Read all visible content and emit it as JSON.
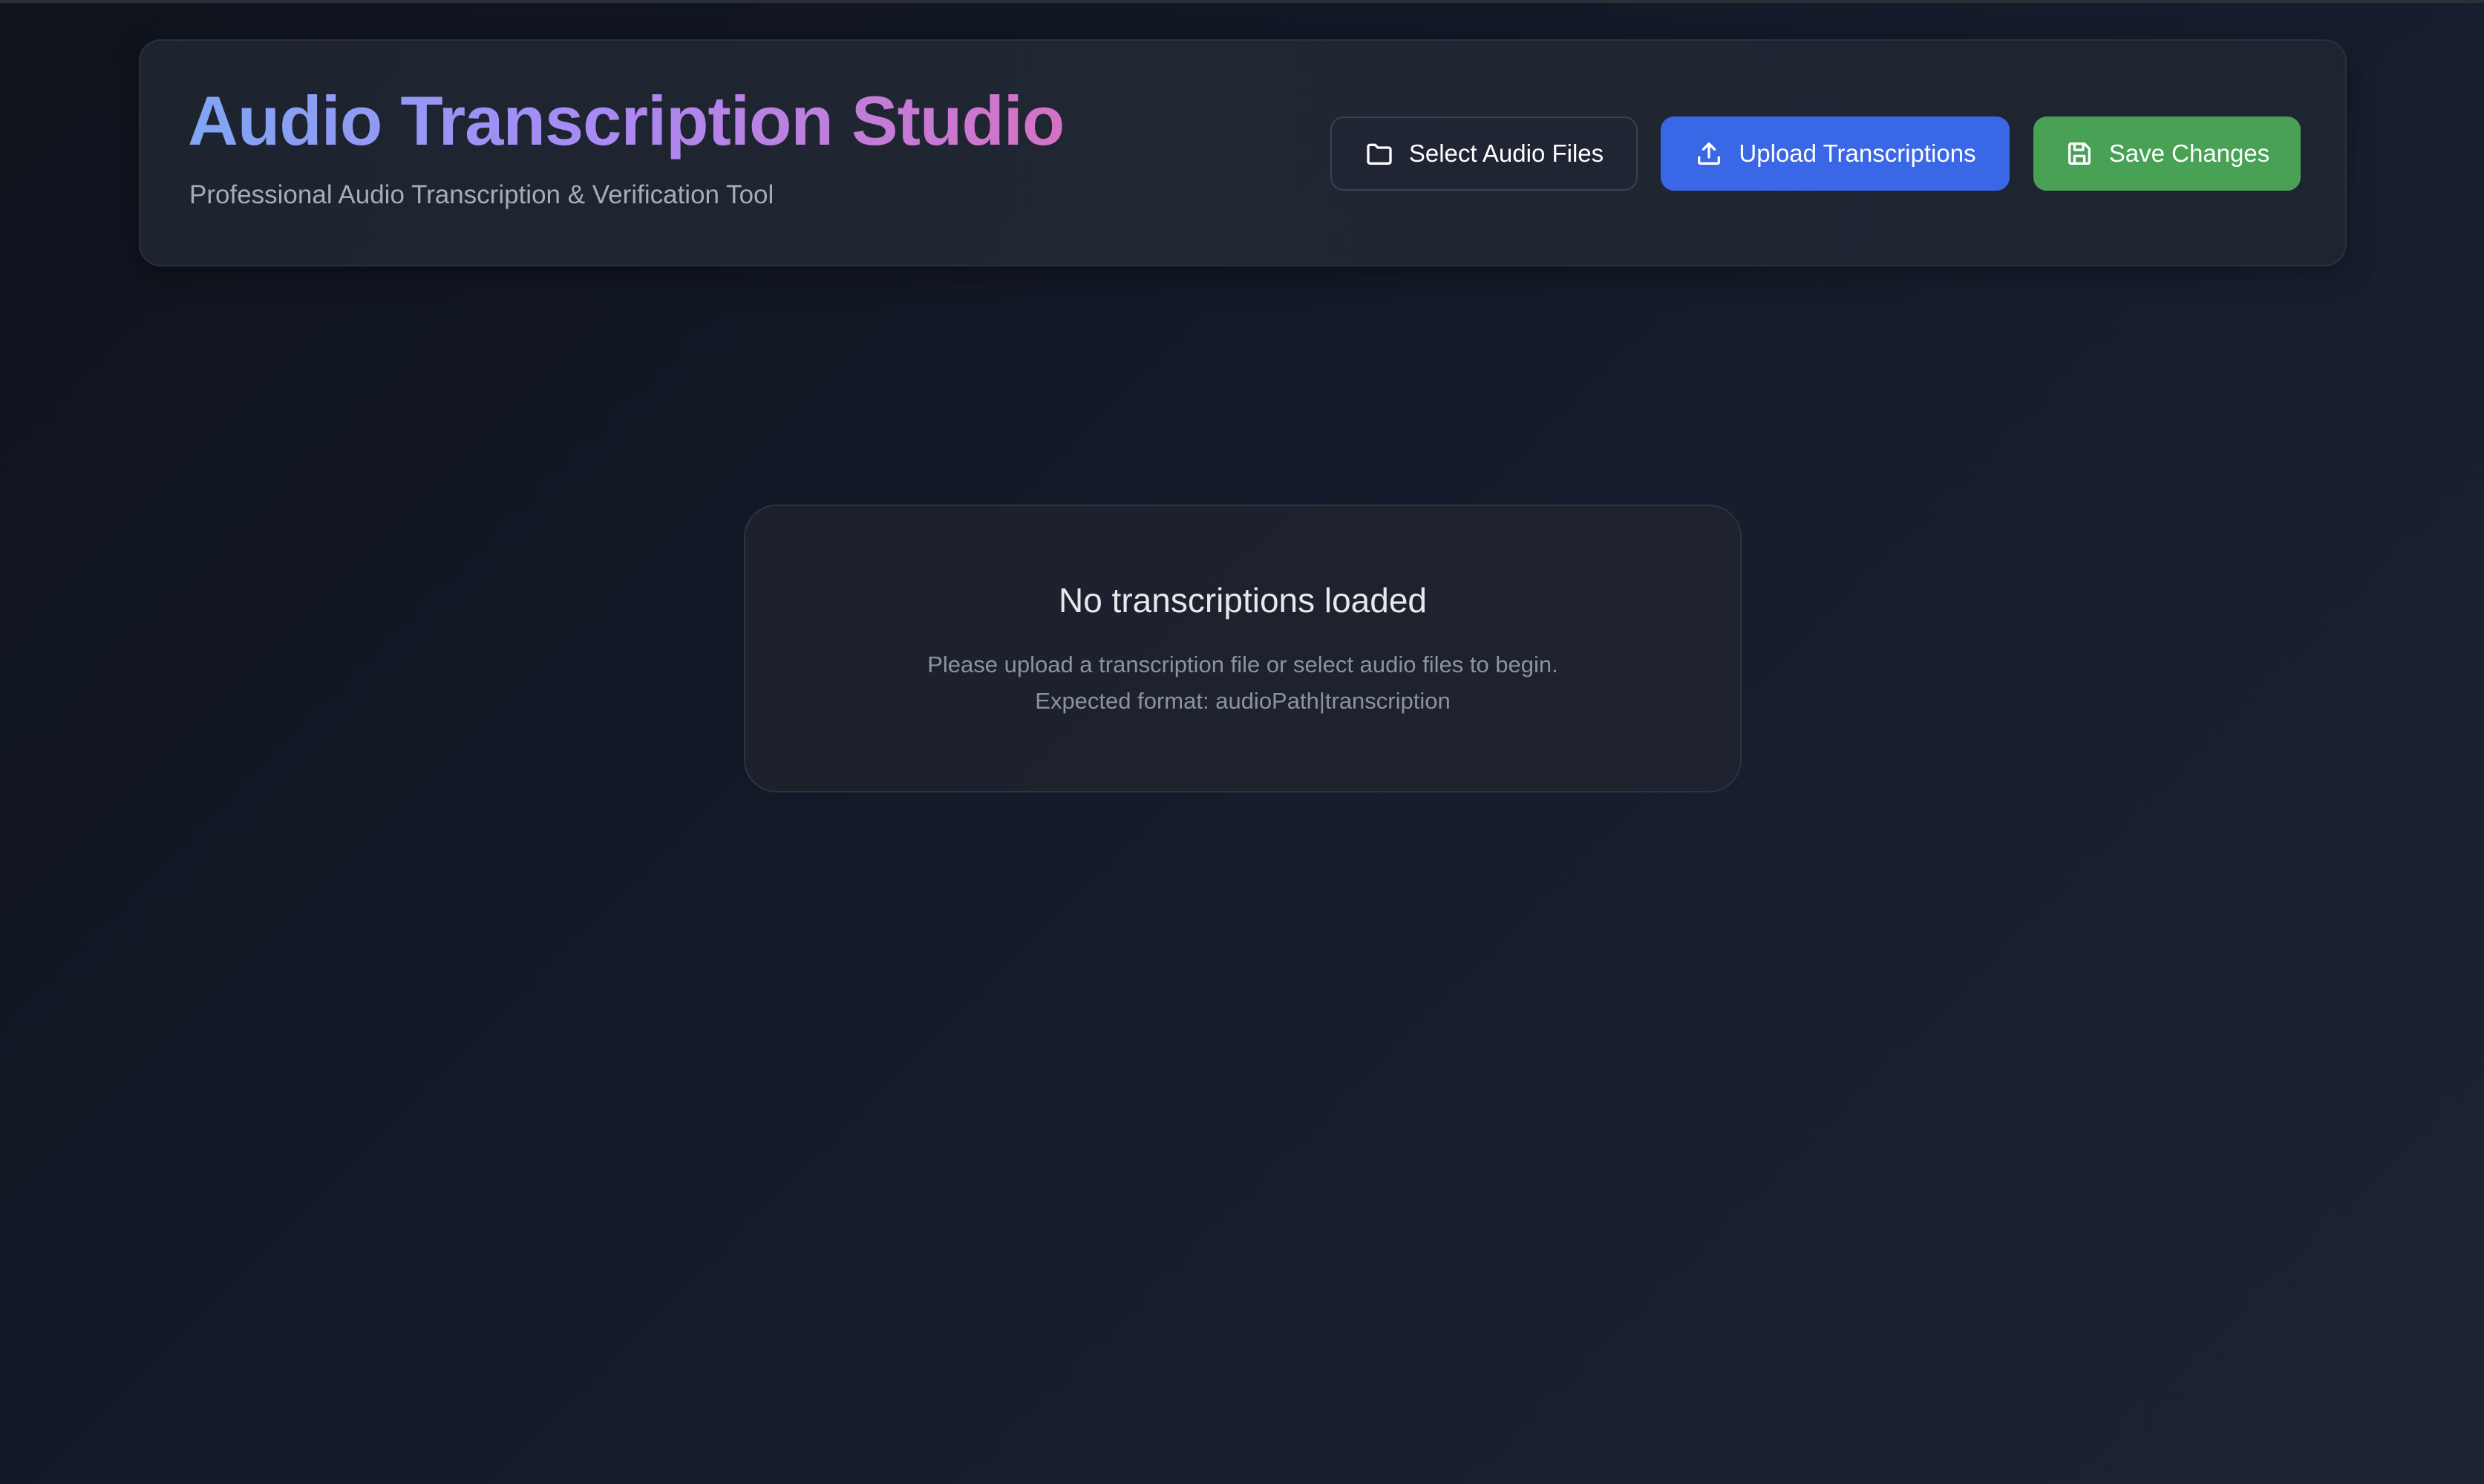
{
  "header": {
    "title": "Audio Transcription Studio",
    "subtitle": "Professional Audio Transcription & Verification Tool",
    "title_gradient": [
      "#7fa6f4",
      "#a78bf5",
      "#d472c4"
    ]
  },
  "toolbar": {
    "select_audio": {
      "label": "Select Audio Files",
      "icon": "folder-icon",
      "color": "#1f2532"
    },
    "upload_transcriptions": {
      "label": "Upload Transcriptions",
      "icon": "upload-icon",
      "color": "#3a67e6"
    },
    "save_changes": {
      "label": "Save Changes",
      "icon": "save-icon",
      "color": "#48a154"
    }
  },
  "empty_state": {
    "title": "No transcriptions loaded",
    "message": "Please upload a transcription file or select audio files to begin.",
    "format_hint": "Expected format: audioPath|transcription"
  }
}
